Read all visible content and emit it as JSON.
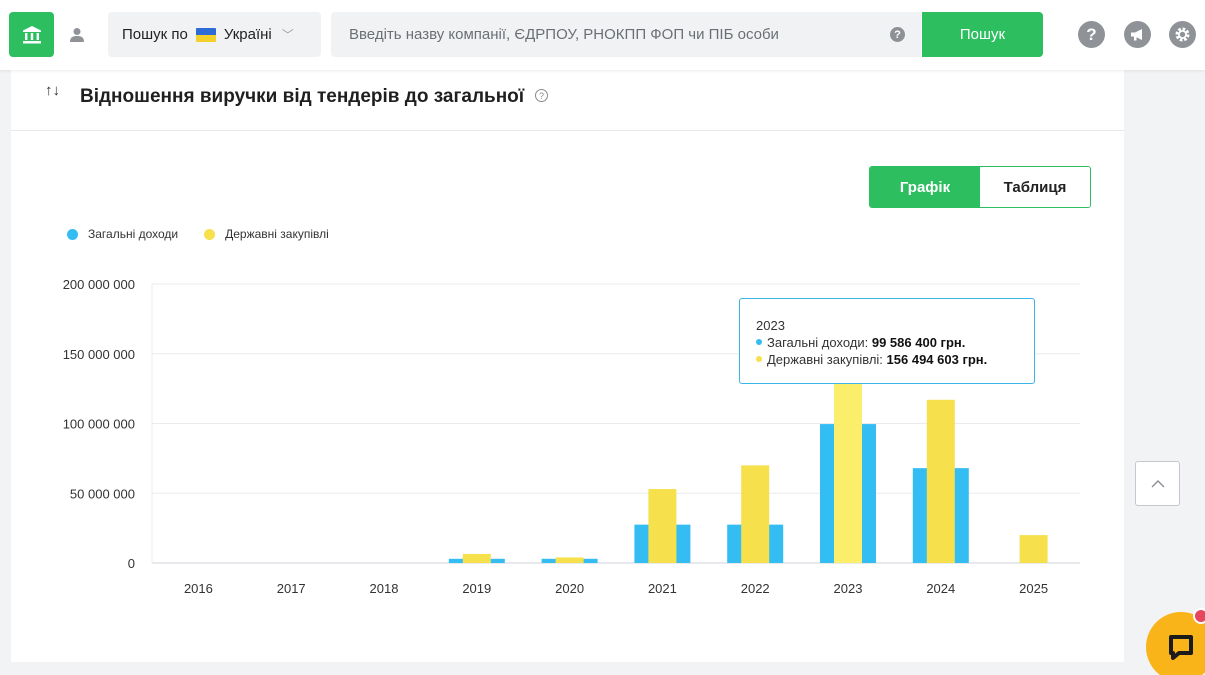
{
  "header": {
    "search_prefix": "Пошук по",
    "country": "Україні",
    "search_placeholder": "Введіть назву компанії, ЄДРПОУ, РНОКПП ФОП чи ПІБ особи",
    "search_button": "Пошук",
    "icons": [
      "bank-icon",
      "user-icon",
      "flag-ukraine-icon",
      "chevron-down-icon",
      "help-icon",
      "megaphone-icon",
      "settings-icon"
    ]
  },
  "card": {
    "title": "Відношення виручки від тендерів до загальної",
    "view_toggle": [
      "Графік",
      "Таблиця"
    ],
    "active_view": "Графік"
  },
  "tooltip": {
    "year": "2023",
    "line1_label": "Загальні доходи: ",
    "line1_value": "99 586 400 грн.",
    "line2_label": "Державні закупівлі: ",
    "line2_value": "156 494 603 грн."
  },
  "colors": {
    "accent_green": "#2dbe60",
    "series_total": "#33bdf3",
    "series_public": "#f6e04c",
    "series_public_highlight": "#fbee6a",
    "tooltip_border": "#3cb4e6"
  },
  "chart_data": {
    "type": "bar",
    "categories": [
      "2016",
      "2017",
      "2018",
      "2019",
      "2020",
      "2021",
      "2022",
      "2023",
      "2024",
      "2025"
    ],
    "series": [
      {
        "name": "Загальні доходи",
        "color": "#33bdf3",
        "values": [
          0,
          0,
          0,
          3000000,
          3000000,
          27500000,
          27500000,
          99586400,
          68000000,
          0
        ]
      },
      {
        "name": "Державні закупівлі",
        "color": "#f6e04c",
        "values": [
          0,
          0,
          0,
          6500000,
          4000000,
          53000000,
          70000000,
          156494603,
          117000000,
          20000000
        ]
      }
    ],
    "y_ticks": [
      "0",
      "50 000 000",
      "100 000 000",
      "150 000 000",
      "200 000 000"
    ],
    "ylim": [
      0,
      200000000
    ],
    "grid": true,
    "legend_position": "top-left"
  }
}
